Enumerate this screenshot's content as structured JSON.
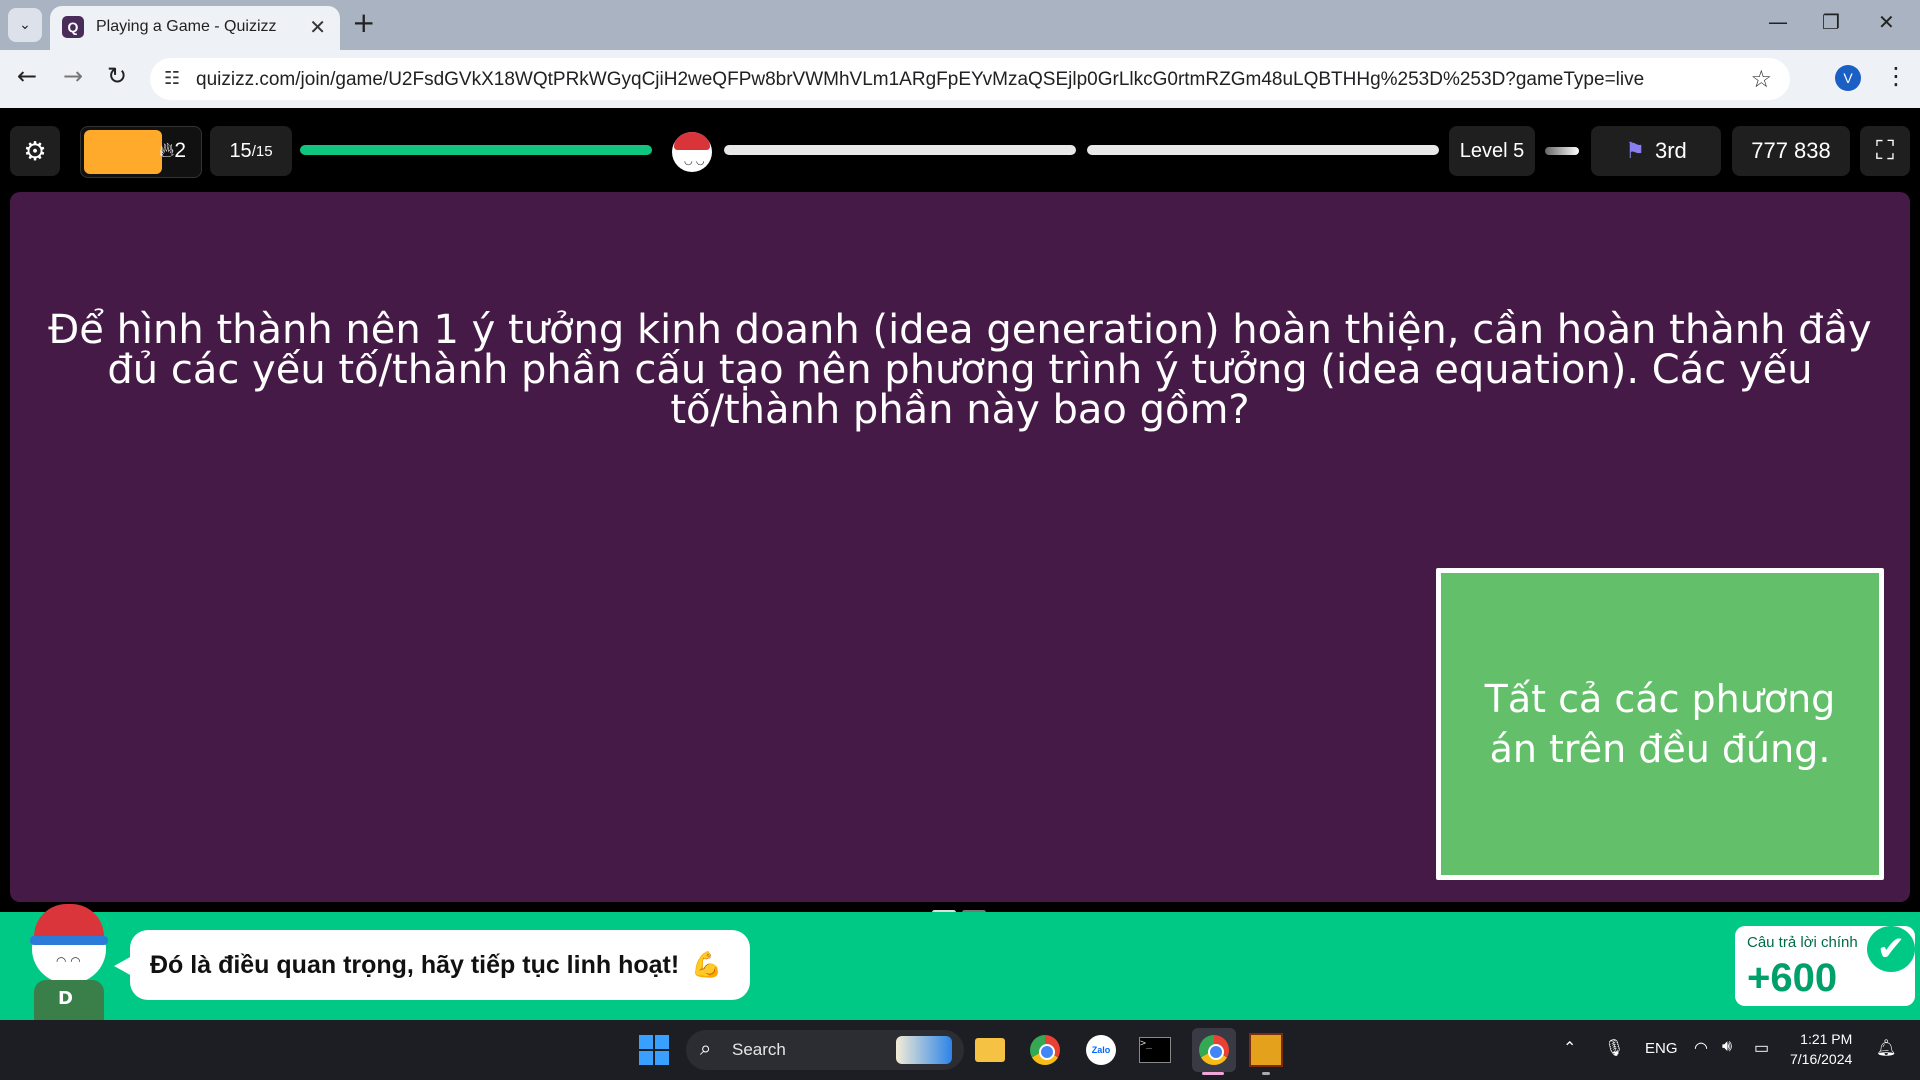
{
  "browser": {
    "tab_title": "Playing a Game - Quizizz",
    "url": "quizizz.com/join/game/U2FsdGVkX18WQtPRkWGyqCjiH2weQFPw8brVWMhVLm1ARgFpEYvMzaQSEjlp0GrLlkcG0rtmRZGm48uLQBTHHg%253D%253D?gameType=live",
    "profile_initial": "V"
  },
  "game": {
    "streak": "2",
    "question_current": "15",
    "question_total": "/15",
    "level": "Level 5",
    "rank": "3rd",
    "score": "777 838"
  },
  "question": {
    "text": "Để hình thành nên 1 ý tưởng kinh doanh (idea generation) hoàn thiện, cần hoàn thành đầy đủ các yếu tố/thành phần cấu tạo nên phương trình ý tưởng (idea equation). Các yếu tố/thành phần này bao gồm?",
    "answer": "Tất cả các phương án trên đều đúng."
  },
  "feedback": {
    "message": "Đó là điều quan trọng, hãy tiếp tục linh hoạt!",
    "emoji": "💪",
    "reward_label": "Câu trả lời chính",
    "reward_points": "+600"
  },
  "taskbar": {
    "search_label": "Search",
    "lang": "ENG",
    "time": "1:21 PM",
    "date": "7/16/2024"
  },
  "colors": {
    "question_bg": "#461a47",
    "answer_bg": "#63bf6a",
    "banner_bg": "#00c985",
    "progress_fill": "#10c67f"
  }
}
